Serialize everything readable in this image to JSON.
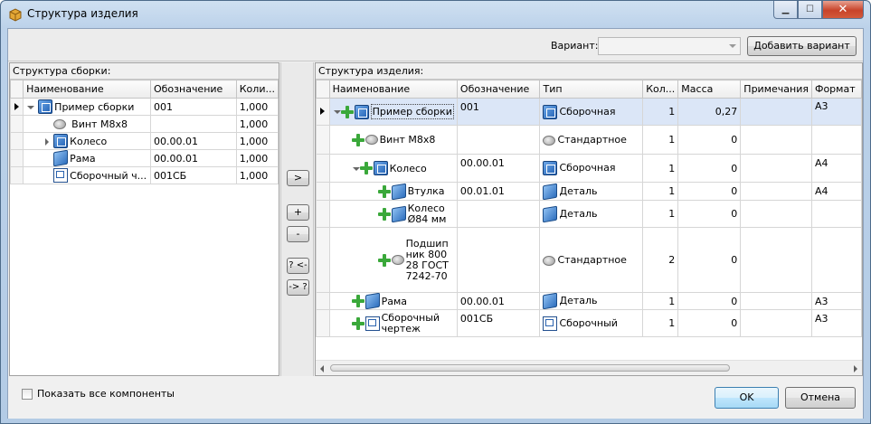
{
  "window": {
    "title": "Структура изделия",
    "controls": {
      "minimize": "▁",
      "maximize": "☐",
      "close": "✕"
    }
  },
  "top": {
    "variant_label": "Вариант:",
    "variant_value": "",
    "add_variant": "Добавить вариант"
  },
  "left": {
    "title": "Структура сборки:",
    "columns": [
      "Наименование",
      "Обозначение",
      "Коли..."
    ],
    "rows": [
      {
        "name": "Пример сборки",
        "designation": "001",
        "qty": "1,000",
        "icon": "assembly-icon"
      },
      {
        "name": "Винт М8х8",
        "designation": "",
        "qty": "1,000",
        "icon": "standard-part-icon"
      },
      {
        "name": "Колесо",
        "designation": "00.00.01",
        "qty": "1,000",
        "icon": "assembly-icon"
      },
      {
        "name": "Рама",
        "designation": "00.00.01",
        "qty": "1,000",
        "icon": "part-icon"
      },
      {
        "name": "Сборочный ч...",
        "designation": "001СБ",
        "qty": "1,000",
        "icon": "drawing-icon"
      }
    ]
  },
  "mid": {
    "add": ">",
    "plus": "+",
    "minus": "-",
    "q_left": "? <-",
    "q_right": "-> ?"
  },
  "right": {
    "title": "Структура изделия:",
    "columns": [
      "Наименование",
      "Обозначение",
      "Тип",
      "Кол...",
      "Масса",
      "Примечания",
      "Формат"
    ],
    "rows": [
      {
        "name": "Пример сборки",
        "designation": "001",
        "type": "Сборочная",
        "qty": "1",
        "mass": "0,27",
        "notes": "",
        "format": "А3"
      },
      {
        "name": "Винт М8х8",
        "designation": "",
        "type": "Стандартное",
        "qty": "1",
        "mass": "0",
        "notes": "",
        "format": ""
      },
      {
        "name": "Колесо",
        "designation": "00.00.01",
        "type": "Сборочная",
        "qty": "1",
        "mass": "0",
        "notes": "",
        "format": "А4"
      },
      {
        "name": "Втулка",
        "designation": "00.01.01",
        "type": "Деталь",
        "qty": "1",
        "mass": "0",
        "notes": "",
        "format": "А4"
      },
      {
        "name": "Колесо Ø84 мм",
        "designation": "",
        "type": "Деталь",
        "qty": "1",
        "mass": "0",
        "notes": "",
        "format": ""
      },
      {
        "name": "Подшипник 80028 ГОСТ 7242-70",
        "designation": "",
        "type": "Стандартное",
        "qty": "2",
        "mass": "0",
        "notes": "",
        "format": ""
      },
      {
        "name": "Рама",
        "designation": "00.00.01",
        "type": "Деталь",
        "qty": "1",
        "mass": "0",
        "notes": "",
        "format": "А3"
      },
      {
        "name": "Сборочный чертеж",
        "designation": "001СБ",
        "type": "Сборочный",
        "qty": "1",
        "mass": "0",
        "notes": "",
        "format": "А3"
      }
    ]
  },
  "bottom": {
    "show_all": "Показать все компоненты",
    "ok": "OK",
    "cancel": "Отмена"
  }
}
